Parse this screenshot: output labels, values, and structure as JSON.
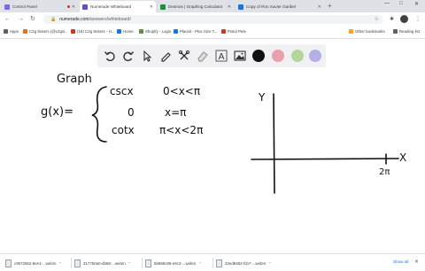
{
  "browser": {
    "tabs": [
      {
        "title": "Control Panel",
        "favicon_color": "#7b68ee",
        "recording": true,
        "active": false
      },
      {
        "title": "Numerade Whiteboard",
        "favicon_color": "#5b4fd6",
        "active": true
      },
      {
        "title": "Desmos | Graphing Calculator",
        "favicon_color": "#1e8e3e",
        "active": false
      },
      {
        "title": "Copy of Ron Xavier Garibel",
        "favicon_color": "#1a73e8",
        "active": false
      }
    ],
    "new_tab": "+",
    "window_controls": [
      "—",
      "□",
      "✕"
    ],
    "address": {
      "domain": "numerade.com",
      "path": "/answers/whiteboard/"
    },
    "nav": {
      "back": "←",
      "forward": "→",
      "reload": "↻"
    }
  },
  "bookmarks": {
    "items": [
      {
        "label": "Apps",
        "color": "#5f6368"
      },
      {
        "label": "C2g Sisters (@c2gsi...",
        "color": "#e37400"
      },
      {
        "label": "(18) C2g Sisters - H...",
        "color": "#d93025"
      },
      {
        "label": "Home",
        "color": "#1a73e8"
      },
      {
        "label": "Shopify - Login",
        "color": "#5e8e3e"
      },
      {
        "label": "Placeit - Plus Size T...",
        "color": "#1a73e8"
      },
      {
        "label": "Pistol Pete",
        "color": "#d93025"
      }
    ],
    "other": "Other bookmarks",
    "reading": "Reading list"
  },
  "whiteboard": {
    "tools": [
      "undo-icon",
      "redo-icon",
      "pen-icon",
      "tools-icon",
      "eraser-icon",
      "text-icon",
      "image-icon"
    ],
    "text_tool_label": "A",
    "colors": [
      "#111111",
      "#e8a0ab",
      "#b5d69b",
      "#b3b0e8"
    ],
    "handwriting": {
      "heading": "Graph",
      "function": "g(x)=",
      "case1_expr": "cscx",
      "case1_cond": "0<x<π",
      "case2_expr": "0",
      "case2_cond": "x=π",
      "case3_expr": "cotx",
      "case3_cond": "π<x<2π",
      "y_axis": "Y",
      "x_axis": "X",
      "x_tick": "2π"
    }
  },
  "downloads": {
    "items": [
      "c9672662-8ee1-...webm",
      "317750a0-db68-...webm",
      "5b969c85-e6c3-...webm",
      "32ed8482-fcb7-...webm"
    ],
    "show_all": "Show all",
    "close": "✕"
  }
}
